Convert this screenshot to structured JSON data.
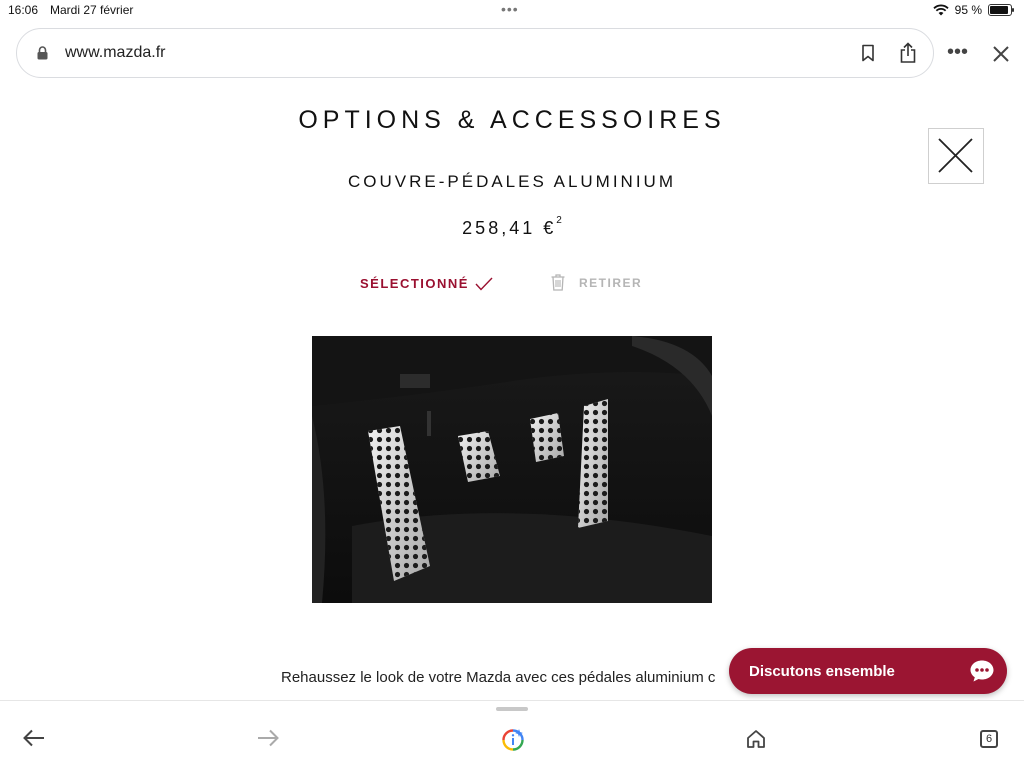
{
  "status_bar": {
    "time": "16:06",
    "date": "Mardi 27 février",
    "battery": "95 %",
    "battery_level": 0.95
  },
  "browser": {
    "url": "www.mazda.fr",
    "open_tabs": "6"
  },
  "page": {
    "title": "OPTIONS & ACCESSOIRES",
    "product_name": "COUVRE-PÉDALES ALUMINIUM",
    "price": "258,41 €",
    "price_note": "2",
    "selected_label": "SÉLECTIONNÉ",
    "remove_label": "RETIRER",
    "description": "Rehaussez le look de votre Mazda avec ces pédales aluminium c"
  },
  "chat": {
    "label": "Discutons ensemble"
  },
  "colors": {
    "brand_red": "#9b1532",
    "selected_red": "#9a1030",
    "disabled_gray": "#b5b5b5"
  }
}
